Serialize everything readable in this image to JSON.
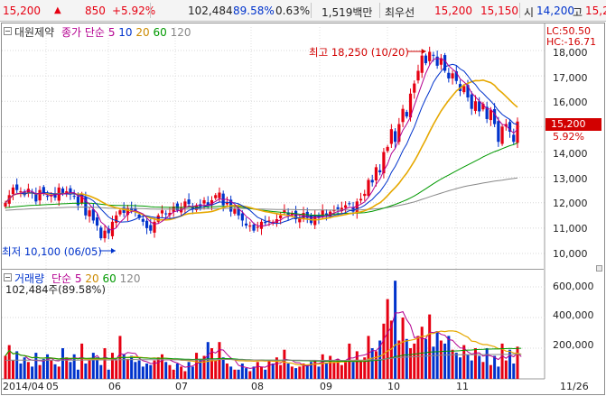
{
  "ticker": {
    "price": "15,200",
    "up_arrow": "▲",
    "change": "850",
    "change_pct": "+5.92%",
    "volume": "102,484",
    "volume_ratio": "89.58%",
    "turnover": "0.63%",
    "amount": "1,519백만",
    "best_offer_label": "최우선",
    "best_ask": "15,200",
    "best_bid": "15,150",
    "open_label": "시",
    "open": "14,200",
    "high_label": "고",
    "high": "15,2"
  },
  "price_panel": {
    "title": "대원제약",
    "ma_label": "종가 단순",
    "ma": [
      "5",
      "10",
      "20",
      "60",
      "120"
    ],
    "max_annotation": "최고 18,250 (10/20)",
    "min_annotation": "최저 10,100 (06/05)",
    "y_ticks": [
      "18,000",
      "17,000",
      "16,000",
      "15,000",
      "14,000",
      "13,000",
      "12,000",
      "11,000",
      "10,000"
    ],
    "current_price": "15,200",
    "current_pct": "5.92%",
    "lc": "LC:50.50",
    "hc": "HC:-16.71"
  },
  "volume_panel": {
    "title": "거래량",
    "ma_label": "단순",
    "ma": [
      "5",
      "20",
      "60",
      "120"
    ],
    "current": "102,484주(89.58%)",
    "y_ticks": [
      "600,000",
      "400,000",
      "200,000"
    ]
  },
  "x_ticks": [
    "2014/04",
    "05",
    "06",
    "07",
    "08",
    "09",
    "10",
    "11",
    "11/26"
  ],
  "colors": {
    "up": "#e60012",
    "down": "#0033cc",
    "ma5": "#b40090",
    "ma10": "#0033cc",
    "ma20": "#e6a800",
    "ma60": "#009900",
    "ma120": "#888888"
  },
  "chart_data": [
    {
      "type": "candlestick",
      "title": "대원제약",
      "ylim": [
        9800,
        18400
      ],
      "y_ticks": [
        10000,
        11000,
        12000,
        13000,
        14000,
        15000,
        16000,
        17000,
        18000
      ],
      "x_start": "2014/04",
      "x_end": "11/26",
      "annotations": [
        {
          "text": "최고 18,250 (10/20)",
          "value": 18250,
          "date": "10/20"
        },
        {
          "text": "최저 10,100 (06/05)",
          "value": 10100,
          "date": "06/05"
        }
      ],
      "last_close": 15200,
      "series_close": [
        12000,
        12300,
        12600,
        12500,
        12450,
        12300,
        12550,
        12400,
        12050,
        12500,
        12350,
        12250,
        12300,
        12200,
        12600,
        12350,
        12450,
        12350,
        12250,
        11900,
        12350,
        11500,
        11700,
        11300,
        11100,
        10600,
        10900,
        10800,
        11250,
        11500,
        11700,
        11600,
        11800,
        11700,
        11650,
        11400,
        11250,
        11000,
        10900,
        11250,
        11500,
        11700,
        11550,
        11600,
        11850,
        11700,
        11800,
        12050,
        11950,
        11750,
        11900,
        11850,
        12100,
        11900,
        12100,
        12300,
        12400,
        11900,
        12000,
        11650,
        11750,
        11500,
        11300,
        11100,
        11100,
        10900,
        11050,
        11250,
        11200,
        11300,
        11250,
        11350,
        11500,
        11700,
        11500,
        11600,
        11350,
        11400,
        11600,
        11400,
        11200,
        11500,
        11400,
        11700,
        11500,
        11650,
        11700,
        11750,
        11800,
        11900,
        11950,
        11650,
        12050,
        12150,
        12350,
        12900,
        12800,
        13400,
        13200,
        14000,
        14200,
        14900,
        14400,
        15100,
        15700,
        15400,
        16300,
        16700,
        17200,
        17800,
        17500,
        17950,
        17800,
        17400,
        17700,
        17200,
        16900,
        17100,
        16800,
        16400,
        16600,
        16150,
        15700,
        16000,
        15600,
        15900,
        15300,
        15650,
        15100,
        14400,
        15000,
        15100,
        14800,
        14400,
        15200
      ]
    },
    {
      "type": "bar",
      "title": "거래량",
      "ylim": [
        0,
        700000
      ],
      "y_ticks": [
        200000,
        400000,
        600000
      ],
      "last_value": 102484,
      "values": [
        150000,
        220000,
        120000,
        180000,
        100000,
        140000,
        110000,
        80000,
        170000,
        90000,
        130000,
        160000,
        120000,
        95000,
        80000,
        200000,
        140000,
        110000,
        160000,
        60000,
        230000,
        100000,
        120000,
        170000,
        140000,
        90000,
        200000,
        60000,
        170000,
        120000,
        280000,
        160000,
        130000,
        150000,
        110000,
        120000,
        80000,
        100000,
        90000,
        120000,
        140000,
        160000,
        110000,
        90000,
        60000,
        100000,
        80000,
        50000,
        110000,
        80000,
        170000,
        130000,
        150000,
        240000,
        200000,
        120000,
        240000,
        140000,
        100000,
        80000,
        60000,
        60000,
        100000,
        70000,
        50000,
        80000,
        110000,
        80000,
        60000,
        120000,
        100000,
        140000,
        90000,
        190000,
        100000,
        80000,
        70000,
        80000,
        100000,
        90000,
        110000,
        120000,
        80000,
        160000,
        100000,
        150000,
        110000,
        130000,
        90000,
        120000,
        230000,
        110000,
        180000,
        120000,
        140000,
        280000,
        200000,
        180000,
        250000,
        360000,
        520000,
        380000,
        640000,
        250000,
        400000,
        260000,
        200000,
        230000,
        280000,
        340000,
        260000,
        420000,
        210000,
        310000,
        250000,
        230000,
        280000,
        190000,
        170000,
        140000,
        220000,
        160000,
        120000,
        200000,
        150000,
        110000,
        200000,
        90000,
        150000,
        80000,
        230000,
        120000,
        190000,
        100000,
        210000,
        102484
      ]
    }
  ]
}
